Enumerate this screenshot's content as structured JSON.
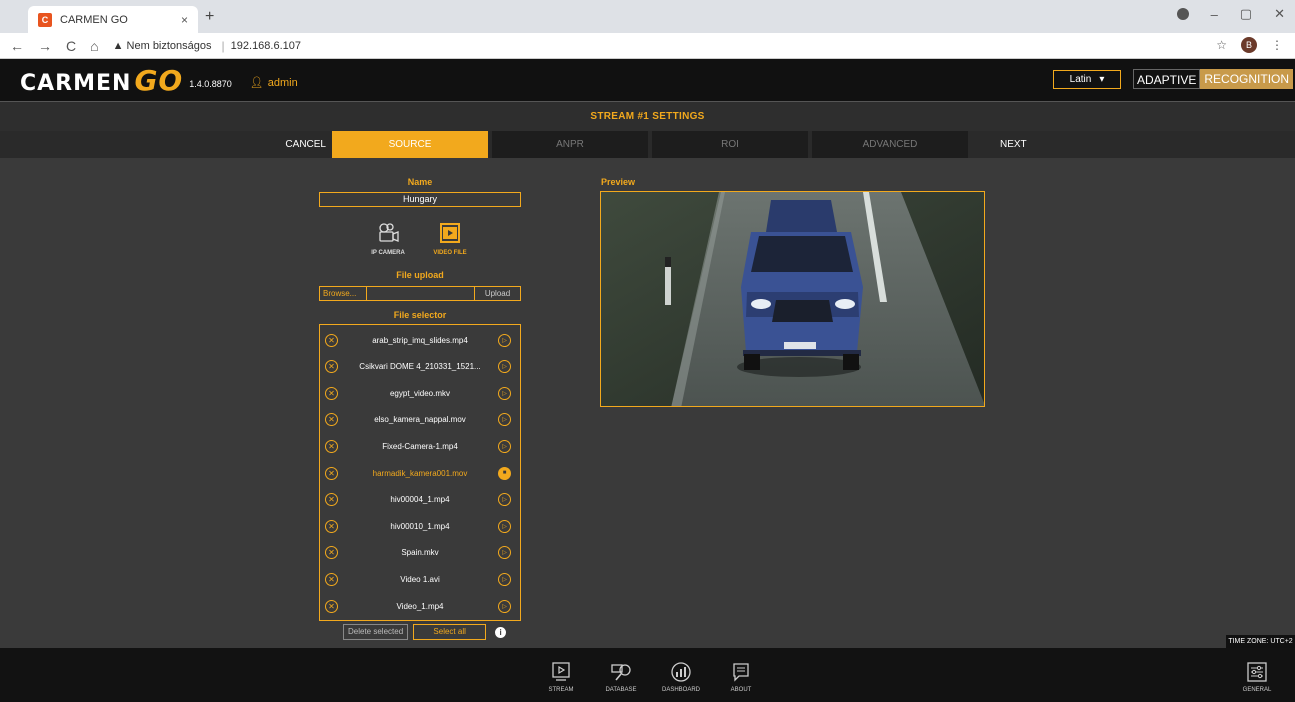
{
  "browser": {
    "tab_title": "CARMEN GO",
    "tab_close": "×",
    "new_tab": "+",
    "nav_back": "←",
    "nav_forward": "→",
    "nav_reload": "C",
    "nav_home": "⌂",
    "security": "▲ Nem biztonságos",
    "url": "192.168.6.107",
    "star": "☆",
    "profile_initial": "B",
    "menu": "⋮"
  },
  "header": {
    "logo_text": "CARMEN",
    "logo_go": "GO",
    "version": "1.4.0.8870",
    "user": "admin",
    "language": "Latin",
    "brand_left": "ADAPTIVE",
    "brand_right": "RECOGNITION"
  },
  "page_title": "STREAM #1 SETTINGS",
  "steps": {
    "cancel": "CANCEL",
    "source": "SOURCE",
    "anpr": "ANPR",
    "roi": "ROI",
    "advanced": "ADVANCED",
    "next": "NEXT"
  },
  "form": {
    "name_label": "Name",
    "name_value": "Hungary",
    "ip_camera": "IP CAMERA",
    "video_file": "VIDEO FILE",
    "file_upload_label": "File upload",
    "browse": "Browse...",
    "upload": "Upload",
    "file_selector_label": "File selector",
    "files": [
      "arab_strip_imq_slides.mp4",
      "Csikvari DOME 4_210331_1521...",
      "egypt_video.mkv",
      "elso_kamera_nappal.mov",
      "Fixed-Camera-1.mp4",
      "harmadik_kamera001.mov",
      "hiv00004_1.mp4",
      "hiv00010_1.mp4",
      "Spain.mkv",
      "Video 1.avi",
      "Video_1.mp4"
    ],
    "active_file_index": 5,
    "delete_selected": "Delete selected",
    "select_all": "Select all"
  },
  "preview_label": "Preview",
  "timezone": "TIME ZONE: UTC+2",
  "footer": {
    "stream": "STREAM",
    "database": "DATABASE",
    "dashboard": "DASHBOARD",
    "about": "ABOUT",
    "general": "GENERAL"
  },
  "colors": {
    "accent": "#f2a91d",
    "background": "#3a3a3a"
  }
}
